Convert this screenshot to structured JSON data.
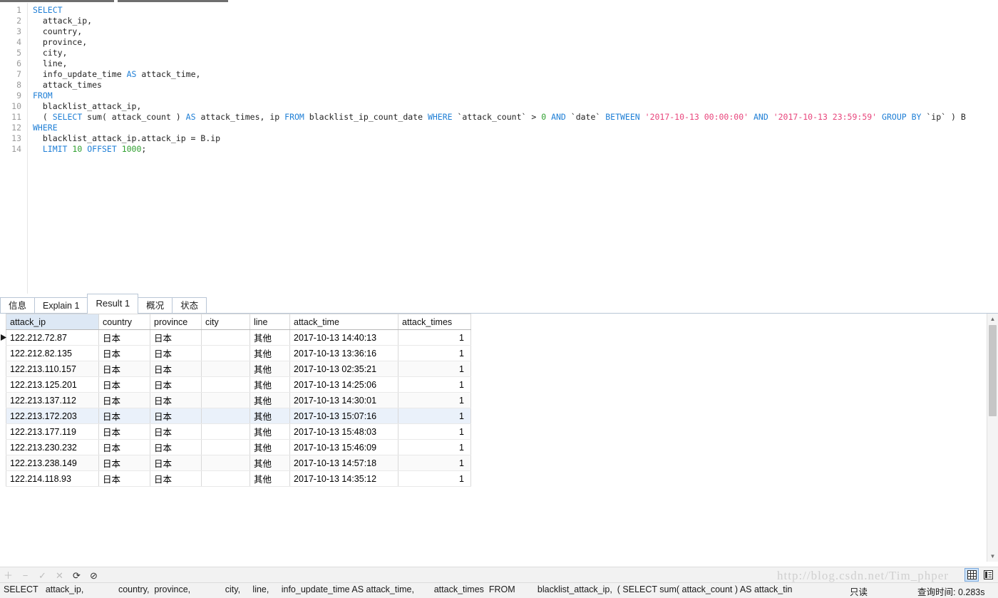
{
  "editor": {
    "lines": [
      {
        "n": "1",
        "tokens": [
          {
            "t": "SELECT",
            "c": "kw"
          }
        ]
      },
      {
        "n": "2",
        "tokens": [
          {
            "t": "  attack_ip,",
            "c": "plain"
          }
        ]
      },
      {
        "n": "3",
        "tokens": [
          {
            "t": "  country,",
            "c": "plain"
          }
        ]
      },
      {
        "n": "4",
        "tokens": [
          {
            "t": "  province,",
            "c": "plain"
          }
        ]
      },
      {
        "n": "5",
        "tokens": [
          {
            "t": "  city,",
            "c": "plain"
          }
        ]
      },
      {
        "n": "6",
        "tokens": [
          {
            "t": "  line,",
            "c": "plain"
          }
        ]
      },
      {
        "n": "7",
        "tokens": [
          {
            "t": "  info_update_time ",
            "c": "plain"
          },
          {
            "t": "AS",
            "c": "kw"
          },
          {
            "t": " attack_time,",
            "c": "plain"
          }
        ]
      },
      {
        "n": "8",
        "tokens": [
          {
            "t": "  attack_times",
            "c": "plain"
          }
        ]
      },
      {
        "n": "9",
        "tokens": [
          {
            "t": "FROM",
            "c": "kw"
          }
        ]
      },
      {
        "n": "10",
        "tokens": [
          {
            "t": "  blacklist_attack_ip,",
            "c": "plain"
          }
        ]
      },
      {
        "n": "11",
        "tokens": [
          {
            "t": "  ( ",
            "c": "plain"
          },
          {
            "t": "SELECT",
            "c": "kw"
          },
          {
            "t": " sum( attack_count ) ",
            "c": "plain"
          },
          {
            "t": "AS",
            "c": "kw"
          },
          {
            "t": " attack_times, ip ",
            "c": "plain"
          },
          {
            "t": "FROM",
            "c": "kw"
          },
          {
            "t": " blacklist_ip_count_date ",
            "c": "plain"
          },
          {
            "t": "WHERE",
            "c": "kw"
          },
          {
            "t": " `attack_count` > ",
            "c": "plain"
          },
          {
            "t": "0",
            "c": "num-lit"
          },
          {
            "t": " ",
            "c": "plain"
          },
          {
            "t": "AND",
            "c": "kw"
          },
          {
            "t": " `date` ",
            "c": "plain"
          },
          {
            "t": "BETWEEN",
            "c": "kw"
          },
          {
            "t": " ",
            "c": "plain"
          },
          {
            "t": "'2017-10-13 00:00:00'",
            "c": "str"
          },
          {
            "t": " ",
            "c": "plain"
          },
          {
            "t": "AND",
            "c": "kw"
          },
          {
            "t": " ",
            "c": "plain"
          },
          {
            "t": "'2017-10-13 23:59:59'",
            "c": "str"
          },
          {
            "t": " ",
            "c": "plain"
          },
          {
            "t": "GROUP BY",
            "c": "kw"
          },
          {
            "t": " `ip` ) B",
            "c": "plain"
          }
        ]
      },
      {
        "n": "12",
        "tokens": [
          {
            "t": "WHERE",
            "c": "kw"
          }
        ]
      },
      {
        "n": "13",
        "tokens": [
          {
            "t": "  blacklist_attack_ip.attack_ip = B.ip",
            "c": "plain"
          }
        ]
      },
      {
        "n": "14",
        "tokens": [
          {
            "t": "  ",
            "c": "plain"
          },
          {
            "t": "LIMIT",
            "c": "kw"
          },
          {
            "t": " ",
            "c": "plain"
          },
          {
            "t": "10",
            "c": "num-lit"
          },
          {
            "t": " ",
            "c": "plain"
          },
          {
            "t": "OFFSET",
            "c": "kw"
          },
          {
            "t": " ",
            "c": "plain"
          },
          {
            "t": "1000",
            "c": "num-lit"
          },
          {
            "t": ";",
            "c": "plain"
          }
        ]
      }
    ]
  },
  "result_tabs": [
    {
      "label": "信息",
      "active": false
    },
    {
      "label": "Explain 1",
      "active": false
    },
    {
      "label": "Result 1",
      "active": true
    },
    {
      "label": "概况",
      "active": false
    },
    {
      "label": "状态",
      "active": false
    }
  ],
  "grid": {
    "columns": [
      {
        "label": "attack_ip",
        "width": 130,
        "align": "left"
      },
      {
        "label": "country",
        "width": 72,
        "align": "left"
      },
      {
        "label": "province",
        "width": 72,
        "align": "left"
      },
      {
        "label": "city",
        "width": 68,
        "align": "left"
      },
      {
        "label": "line",
        "width": 56,
        "align": "left"
      },
      {
        "label": "attack_time",
        "width": 152,
        "align": "left"
      },
      {
        "label": "attack_times",
        "width": 102,
        "align": "right"
      }
    ],
    "rows": [
      {
        "cells": [
          "122.212.72.87",
          "日本",
          "日本",
          "",
          "其他",
          "2017-10-13 14:40:13",
          "1"
        ],
        "marker": true,
        "style": ""
      },
      {
        "cells": [
          "122.212.82.135",
          "日本",
          "日本",
          "",
          "其他",
          "2017-10-13 13:36:16",
          "1"
        ],
        "marker": false,
        "style": ""
      },
      {
        "cells": [
          "122.213.110.157",
          "日本",
          "日本",
          "",
          "其他",
          "2017-10-13 02:35:21",
          "1"
        ],
        "marker": false,
        "style": "alt"
      },
      {
        "cells": [
          "122.213.125.201",
          "日本",
          "日本",
          "",
          "其他",
          "2017-10-13 14:25:06",
          "1"
        ],
        "marker": false,
        "style": ""
      },
      {
        "cells": [
          "122.213.137.112",
          "日本",
          "日本",
          "",
          "其他",
          "2017-10-13 14:30:01",
          "1"
        ],
        "marker": false,
        "style": "alt"
      },
      {
        "cells": [
          "122.213.172.203",
          "日本",
          "日本",
          "",
          "其他",
          "2017-10-13 15:07:16",
          "1"
        ],
        "marker": false,
        "style": "sel"
      },
      {
        "cells": [
          "122.213.177.119",
          "日本",
          "日本",
          "",
          "其他",
          "2017-10-13 15:48:03",
          "1"
        ],
        "marker": false,
        "style": ""
      },
      {
        "cells": [
          "122.213.230.232",
          "日本",
          "日本",
          "",
          "其他",
          "2017-10-13 15:46:09",
          "1"
        ],
        "marker": false,
        "style": ""
      },
      {
        "cells": [
          "122.213.238.149",
          "日本",
          "日本",
          "",
          "其他",
          "2017-10-13 14:57:18",
          "1"
        ],
        "marker": false,
        "style": "alt"
      },
      {
        "cells": [
          "122.214.118.93",
          "日本",
          "日本",
          "",
          "其他",
          "2017-10-13 14:35:12",
          "1"
        ],
        "marker": false,
        "style": ""
      }
    ]
  },
  "bottom_toolbar": {
    "buttons": [
      {
        "name": "add-record-button",
        "glyph": "＋",
        "disabled": true
      },
      {
        "name": "remove-record-button",
        "glyph": "−",
        "disabled": true
      },
      {
        "name": "apply-change-button",
        "glyph": "✓",
        "disabled": true
      },
      {
        "name": "cancel-change-button",
        "glyph": "✕",
        "disabled": true
      },
      {
        "name": "refresh-button",
        "glyph": "⟳",
        "disabled": false
      },
      {
        "name": "stop-button",
        "glyph": "⊘",
        "disabled": false
      }
    ]
  },
  "view_toggle": {
    "grid_view_active": true,
    "form_view_active": false
  },
  "statusbar": {
    "sql": "SELECT   attack_ip,              country,  province,              city,     line,     info_update_time AS attack_time,        attack_times  FROM         blacklist_attack_ip,  ( SELECT sum( attack_count ) AS attack_tin",
    "readonly": "只读",
    "query_time": "查询时间: 0.283s"
  },
  "watermark": "http://blog.csdn.net/Tim_phper",
  "colors": {
    "keyword": "#1f7fd6",
    "number": "#2fa02f",
    "string": "#e8467c",
    "header_first_bg": "#dde8f5",
    "selected_row_bg": "#eaf1fa",
    "toolbar_bg": "#f2f2f2",
    "toggle_active_bg": "#cde2f7"
  }
}
